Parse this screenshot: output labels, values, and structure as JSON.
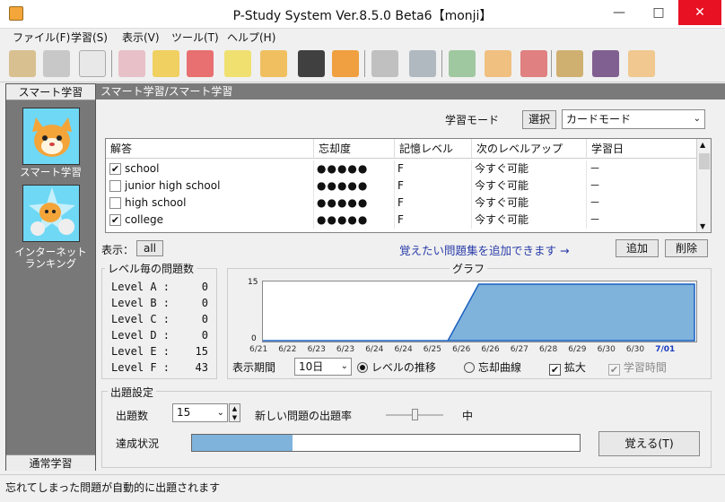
{
  "window": {
    "title": "P-Study System Ver.8.5.0 Beta6【monji】",
    "min": "—",
    "max": "□",
    "close": "✕"
  },
  "menu": [
    "ファイル(F)",
    "学習(S)",
    "表示(V)",
    "ツール(T)",
    "ヘルプ(H)"
  ],
  "toolbar": {
    "groups": [
      [
        "tool-a-icon",
        "tool-b-icon",
        "tool-c-icon"
      ],
      [
        "tool-d-icon",
        "tool-e-icon",
        "tool-f-icon",
        "tool-g-icon",
        "tool-h-icon",
        "tool-i-icon",
        "tool-j-icon"
      ],
      [
        "tool-k-icon",
        "tool-l-icon"
      ],
      [
        "tool-m-icon",
        "tool-n-icon",
        "tool-o-icon"
      ],
      [
        "tool-p-icon",
        "tool-q-icon",
        "tool-r-icon"
      ]
    ]
  },
  "sidebar": {
    "header": "スマート学習",
    "item1": "スマート学習",
    "item2_line1": "インターネット",
    "item2_line2": "ランキング",
    "footer": "通常学習"
  },
  "breadcrumb": "スマート学習/スマート学習",
  "mode": {
    "label": "学習モード",
    "select_btn": "選択",
    "value": "カードモード"
  },
  "table": {
    "headers": [
      "解答",
      "忘却度",
      "記憶レベル",
      "次のレベルアップ",
      "学習日"
    ],
    "rows": [
      {
        "checked": true,
        "answer": "school",
        "forget": "●●●●●",
        "level": "F",
        "next": "今すぐ可能",
        "date": "－"
      },
      {
        "checked": false,
        "answer": "junior high school",
        "forget": "●●●●●",
        "level": "F",
        "next": "今すぐ可能",
        "date": "－"
      },
      {
        "checked": false,
        "answer": "high school",
        "forget": "●●●●●",
        "level": "F",
        "next": "今すぐ可能",
        "date": "－"
      },
      {
        "checked": true,
        "answer": "college",
        "forget": "●●●●●",
        "level": "F",
        "next": "今すぐ可能",
        "date": "－"
      }
    ],
    "check_mark": "✔"
  },
  "display": {
    "label": "表示：",
    "value": "all",
    "hint": "覚えたい問題集を追加できます →",
    "add": "追加",
    "remove": "削除"
  },
  "levels": {
    "title": "レベル毎の問題数",
    "items": [
      {
        "name": "Level A :",
        "count": "0"
      },
      {
        "name": "Level B :",
        "count": "0"
      },
      {
        "name": "Level C :",
        "count": "0"
      },
      {
        "name": "Level D :",
        "count": "0"
      },
      {
        "name": "Level E :",
        "count": "15"
      },
      {
        "name": "Level F :",
        "count": "43"
      }
    ]
  },
  "graph": {
    "title": "グラフ",
    "period_label": "表示期間",
    "period_value": "10日",
    "radio_level": "レベルの推移",
    "radio_forget": "忘却曲線",
    "zoom": "拡大",
    "study_time": "学習時間",
    "fill_color": "#7fb3dc"
  },
  "chart_data": {
    "type": "area",
    "x": [
      "6/21",
      "6/22",
      "6/23",
      "6/23",
      "6/24",
      "6/24",
      "6/25",
      "6/26",
      "6/26",
      "6/27",
      "6/28",
      "6/29",
      "6/30",
      "6/30",
      "7/01"
    ],
    "values": [
      0,
      0,
      0,
      0,
      0,
      0,
      0,
      15,
      15,
      15,
      15,
      15,
      15,
      15,
      15
    ],
    "y_ticks": [
      "15",
      "0"
    ],
    "ylim": [
      0,
      15
    ]
  },
  "settings": {
    "title": "出題設定",
    "count_label": "出題数",
    "count_value": "15",
    "new_rate_label": "新しい問題の出題率",
    "new_rate_value": "中",
    "progress_label": "達成状況",
    "progress": 0.26,
    "remember_btn": "覚える(T)"
  },
  "status": "忘れてしまった問題が自動的に出題されます"
}
